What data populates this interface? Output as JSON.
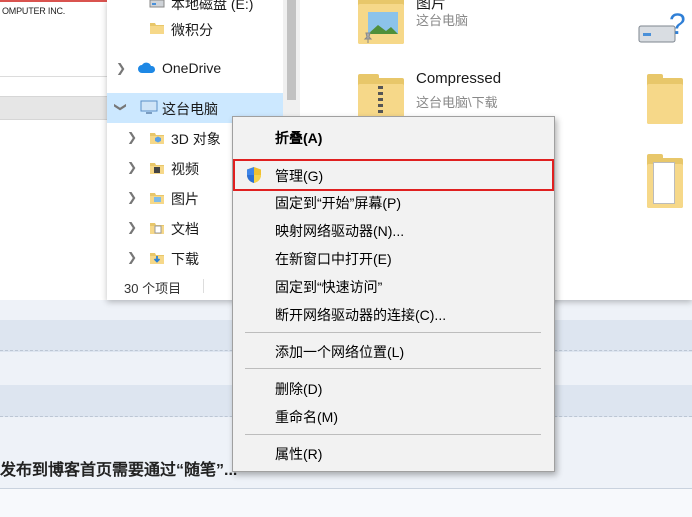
{
  "background_page": {
    "logo_text": "OMPUTER INC.",
    "article_text": "发布到博客首页需要通过“随笔”..."
  },
  "explorer": {
    "nav": {
      "items": [
        {
          "label": "本地磁盘 (E:)",
          "icon": "drive-icon"
        },
        {
          "label": "微积分",
          "icon": "folder-icon"
        },
        {
          "label": "OneDrive",
          "icon": "cloud-icon"
        },
        {
          "label": "这台电脑",
          "icon": "computer-icon"
        },
        {
          "label": "3D 对象",
          "icon": "3d-objects-icon"
        },
        {
          "label": "视频",
          "icon": "video-icon"
        },
        {
          "label": "图片",
          "icon": "pictures-icon"
        },
        {
          "label": "文档",
          "icon": "documents-icon"
        },
        {
          "label": "下载",
          "icon": "downloads-icon"
        }
      ]
    },
    "status": "30 个项目",
    "content": {
      "tiles": [
        {
          "name": "图片",
          "sub": "这台电脑"
        },
        {
          "name": "Compressed",
          "sub": "这台电脑\\下载"
        }
      ]
    }
  },
  "context_menu": {
    "items": [
      {
        "label": "折叠(A)"
      },
      {
        "label": "管理(G)"
      },
      {
        "label": "固定到“开始”屏幕(P)"
      },
      {
        "label": "映射网络驱动器(N)..."
      },
      {
        "label": "在新窗口中打开(E)"
      },
      {
        "label": "固定到“快速访问”"
      },
      {
        "label": "断开网络驱动器的连接(C)..."
      },
      {
        "label": "添加一个网络位置(L)"
      },
      {
        "label": "删除(D)"
      },
      {
        "label": "重命名(M)"
      },
      {
        "label": "属性(R)"
      }
    ]
  },
  "colors": {
    "highlight_border": "#e02020",
    "selection": "#cce8ff",
    "onedrive": "#1e88e5",
    "folder": "#f6d889"
  }
}
